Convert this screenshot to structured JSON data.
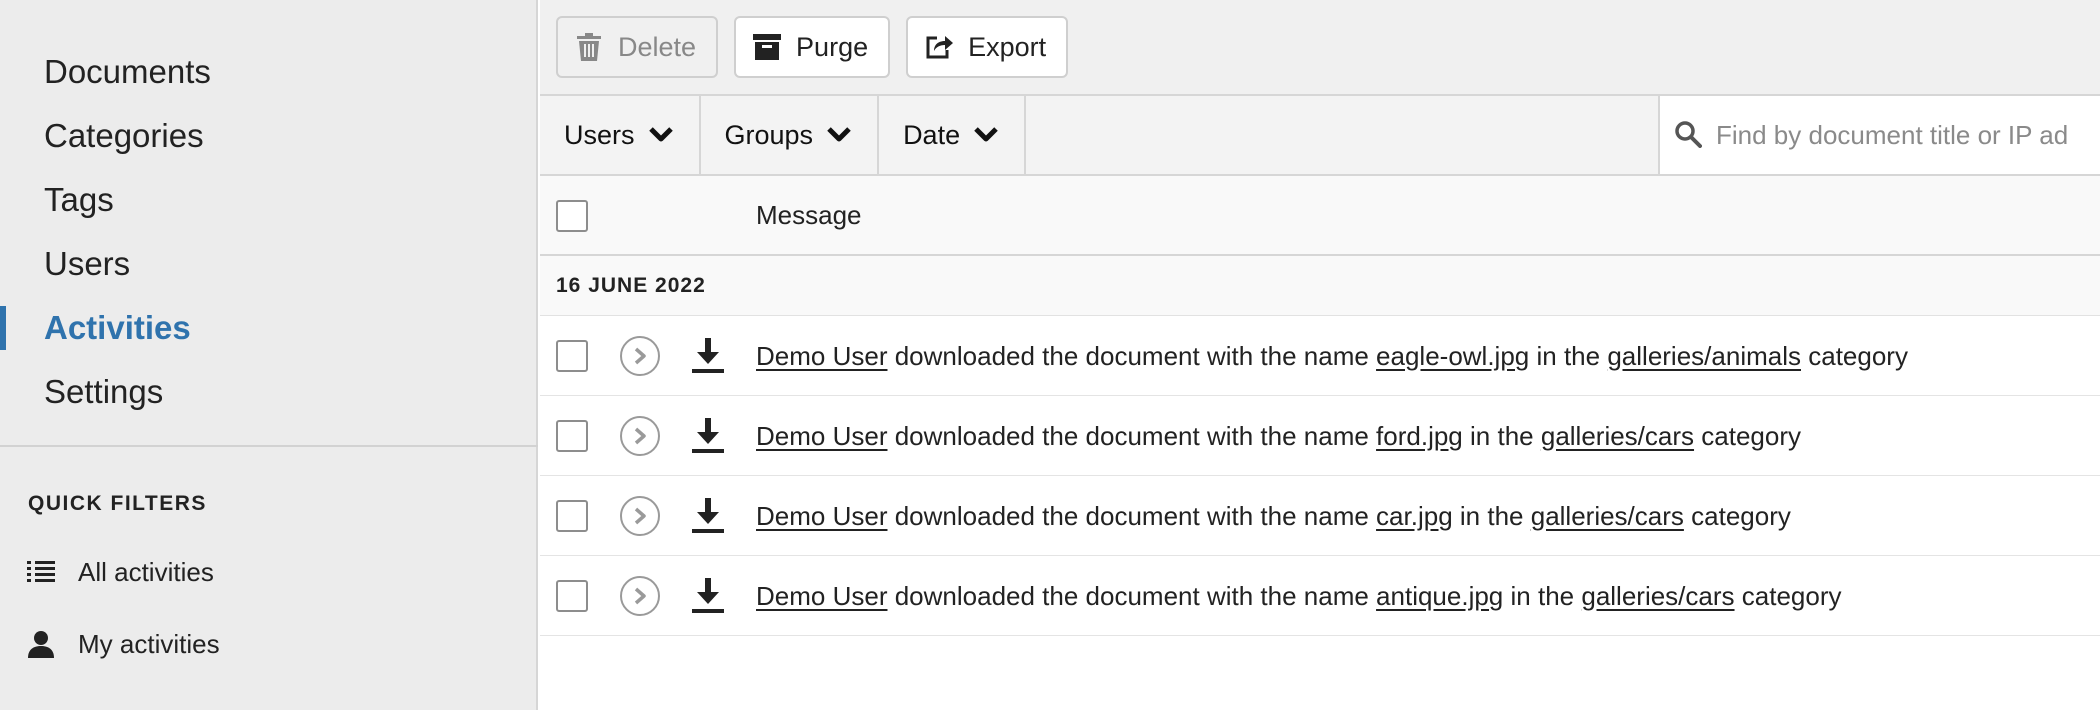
{
  "sidebar": {
    "nav": [
      {
        "label": "Documents",
        "active": false
      },
      {
        "label": "Categories",
        "active": false
      },
      {
        "label": "Tags",
        "active": false
      },
      {
        "label": "Users",
        "active": false
      },
      {
        "label": "Activities",
        "active": true
      },
      {
        "label": "Settings",
        "active": false
      }
    ],
    "quick_filters": {
      "heading": "QUICK FILTERS",
      "items": [
        {
          "label": "All activities",
          "icon": "list-icon"
        },
        {
          "label": "My activities",
          "icon": "user-icon"
        }
      ]
    }
  },
  "toolbar": {
    "delete_label": "Delete",
    "purge_label": "Purge",
    "export_label": "Export"
  },
  "filters": {
    "users_label": "Users",
    "groups_label": "Groups",
    "date_label": "Date",
    "search_placeholder": "Find by document title or IP ad"
  },
  "table": {
    "message_header": "Message",
    "date_group": "16 JUNE 2022",
    "rows": [
      {
        "user": "Demo User",
        "action": "downloaded the document with the name",
        "document": "eagle-owl.jpg",
        "in_the": "in the",
        "category": "galleries/animals",
        "suffix": "category"
      },
      {
        "user": "Demo User",
        "action": "downloaded the document with the name",
        "document": "ford.jpg",
        "in_the": "in the",
        "category": "galleries/cars",
        "suffix": "category"
      },
      {
        "user": "Demo User",
        "action": "downloaded the document with the name",
        "document": "car.jpg",
        "in_the": "in the",
        "category": "galleries/cars",
        "suffix": "category"
      },
      {
        "user": "Demo User",
        "action": "downloaded the document with the name",
        "document": "antique.jpg",
        "in_the": "in the",
        "category": "galleries/cars",
        "suffix": "category"
      }
    ]
  },
  "colors": {
    "accent": "#2f73ad",
    "sidebar_bg": "#ececec"
  }
}
